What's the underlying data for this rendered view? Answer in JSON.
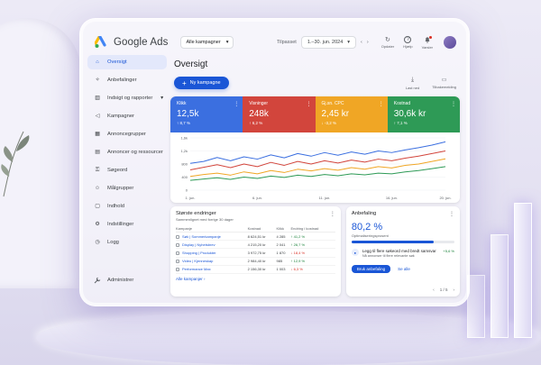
{
  "app": {
    "title": "Google Ads"
  },
  "header": {
    "campaign_select": "Alle kampagner",
    "date_label": "Tilpasset",
    "date_range": "1.–30. jun. 2024",
    "icons": [
      {
        "name": "refresh-icon",
        "label": "Opdater"
      },
      {
        "name": "help-icon",
        "label": "Hjælp"
      },
      {
        "name": "bell-icon",
        "label": "Varsler"
      }
    ]
  },
  "sidebar": {
    "items": [
      {
        "label": "Oversigt",
        "icon": "home-icon",
        "active": true
      },
      {
        "label": "Anbefalinger",
        "icon": "bulb-icon"
      },
      {
        "label": "Indsigt og rapporter",
        "icon": "insight-icon"
      },
      {
        "label": "Kampagner",
        "icon": "megaphone-icon"
      },
      {
        "label": "Annoncegrupper",
        "icon": "group-icon"
      },
      {
        "label": "Annoncer og ressourcer",
        "icon": "ads-icon"
      },
      {
        "label": "Søgeord",
        "icon": "key-icon"
      },
      {
        "label": "Målgrupper",
        "icon": "people-icon"
      },
      {
        "label": "Indhold",
        "icon": "content-icon"
      },
      {
        "label": "Indstillinger",
        "icon": "settings-icon"
      },
      {
        "label": "Logg",
        "icon": "history-icon"
      }
    ],
    "admin": "Administrer"
  },
  "main": {
    "title": "Oversigt",
    "new_campaign": "Ny kampagne",
    "actions": [
      {
        "label": "Last ned",
        "icon": "download-icon"
      },
      {
        "label": "Tilbakemelding",
        "icon": "feedback-icon"
      }
    ]
  },
  "kpis": [
    {
      "label": "Klikk",
      "value": "12,5k",
      "delta": "↑ 8,7 %",
      "color": "#3b6fe0"
    },
    {
      "label": "Visninger",
      "value": "248k",
      "delta": "↑ 6,2 %",
      "color": "#d2453c"
    },
    {
      "label": "Gj.sn. CPC",
      "value": "2,45 kr",
      "delta": "↓ -3,2 %",
      "color": "#f0a625"
    },
    {
      "label": "Kostnad",
      "value": "30,6k kr",
      "delta": "↑ 7,1 %",
      "color": "#2e9a56"
    }
  ],
  "chart_data": {
    "type": "line",
    "x": [
      "1. jun.",
      "2. jun.",
      "3. jun.",
      "4. jun.",
      "5. jun.",
      "6. jun.",
      "7. jun.",
      "8. jun.",
      "9. jun.",
      "10. jun.",
      "11. jun.",
      "12. jun.",
      "13. jun.",
      "14. jun.",
      "15. jun.",
      "16. jun.",
      "17. jun.",
      "18. jun.",
      "19. jun.",
      "20. jun."
    ],
    "xticks": [
      "1. jun.",
      "6. jun.",
      "11. jun.",
      "16. jun.",
      "20. jun."
    ],
    "yticks": [
      "0",
      "400",
      "800",
      "1,2k",
      "1,6k"
    ],
    "ylim": [
      0,
      1600
    ],
    "series": [
      {
        "color": "#3b6fe0",
        "values": [
          820,
          880,
          1000,
          900,
          1020,
          950,
          1080,
          990,
          1120,
          1040,
          1150,
          1070,
          1170,
          1100,
          1200,
          1150,
          1230,
          1300,
          1380,
          1480
        ]
      },
      {
        "color": "#d2453c",
        "values": [
          620,
          700,
          780,
          690,
          800,
          720,
          850,
          760,
          880,
          800,
          900,
          830,
          920,
          860,
          950,
          900,
          980,
          1040,
          1120,
          1200
        ]
      },
      {
        "color": "#f0a625",
        "values": [
          420,
          480,
          520,
          460,
          560,
          500,
          600,
          540,
          640,
          590,
          660,
          610,
          690,
          640,
          720,
          680,
          760,
          800,
          880,
          960
        ]
      },
      {
        "color": "#2e9a56",
        "values": [
          300,
          340,
          380,
          330,
          400,
          360,
          430,
          390,
          460,
          420,
          480,
          440,
          500,
          470,
          520,
          500,
          560,
          600,
          660,
          720
        ]
      }
    ]
  },
  "changes": {
    "title": "Største endringer",
    "subtitle": "Sammenlignet med forrige 30 dager",
    "columns": [
      "Kampanje",
      "Kostnad",
      "Klikk",
      "Endring i kostnad"
    ],
    "rows": [
      {
        "name": "Søk | Sommerkampanje",
        "cost": "8 624,51 kr",
        "clicks": "4 285",
        "change": "↑ 41,2 %",
        "dir": "up"
      },
      {
        "name": "Display | Nyhetsbrev",
        "cost": "4 215,20 kr",
        "clicks": "2 041",
        "change": "↑ 26,7 %",
        "dir": "up"
      },
      {
        "name": "Shopping | Produkter",
        "cost": "3 972,75 kr",
        "clicks": "1 870",
        "change": "↓ 18,4 %",
        "dir": "down"
      },
      {
        "name": "Video | Kjenneskap",
        "cost": "2 984,40 kr",
        "clicks": "985",
        "change": "↑ 12,9 %",
        "dir": "up"
      },
      {
        "name": "Performance Max",
        "cost": "2 156,30 kr",
        "clicks": "1 003",
        "change": "↓ 6,3 %",
        "dir": "down"
      }
    ],
    "all_link": "Alle kampanjer"
  },
  "recommendation": {
    "title": "Anbefaling",
    "value": "80,2 %",
    "label": "Optimaliseringsprosent",
    "progress": 0.802,
    "item_title": "Legg til flere søkeord med bredt samsvar",
    "item_sub": "Nå annonser til flere relevante søk",
    "item_gain": "+5,6 %",
    "apply": "Bruk anbefaling",
    "view_all": "Se alle",
    "pager": "1 / 5"
  }
}
